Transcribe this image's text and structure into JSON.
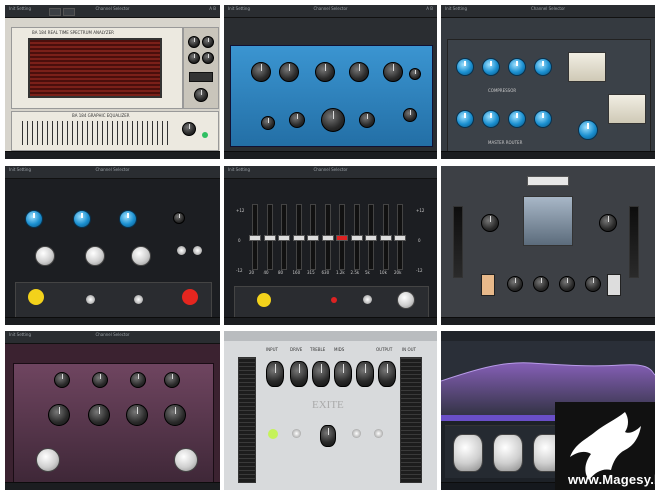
{
  "page": {
    "background": "#ffffff"
  },
  "common": {
    "preset_label": "Init Setting",
    "menu_label": "Channel Selector",
    "ab_label": "A  B",
    "disp_1": "---",
    "disp_2": "<>"
  },
  "tiles": [
    {
      "id": "rta-graphic-eq",
      "header_title": "BA 184 REAL TIME SPECTRUM ANALYZER",
      "footer_title": "BA 184 GRAPHIC EQUALIZER",
      "accent": "#8b1e1a"
    },
    {
      "id": "blue-eq",
      "accent": "#2e8ac7"
    },
    {
      "id": "blue-compressor",
      "section_label": "COMPRESSOR",
      "section_label_2": "MASTER ROUTER",
      "accent": "#1fa2e0"
    },
    {
      "id": "black-eq-blue",
      "accent": "#59b4ef"
    },
    {
      "id": "fader-eq",
      "labels": [
        "20",
        "40",
        "80",
        "160",
        "315",
        "630",
        "1.2k",
        "2.5k",
        "5k",
        "10k",
        "20k"
      ],
      "scale": [
        "+12",
        "0",
        "-12"
      ],
      "accent": "#d22"
    },
    {
      "id": "gray-compressor",
      "accent": "#d88"
    },
    {
      "id": "purple-eq",
      "accent": "#6a3e58"
    },
    {
      "id": "silver-console",
      "labels": [
        "INPUT",
        "DRIVE",
        "TREBLE",
        "MIDS",
        "OUTPUT"
      ],
      "brand": "EXITE",
      "meter_label": "IN OUT",
      "accent": "#c5f25a"
    },
    {
      "id": "spectral-eq",
      "accent": "#7c5bd6"
    }
  ],
  "watermark": {
    "text": "www.Magesy.blog",
    "icon": "griffin-logo"
  }
}
